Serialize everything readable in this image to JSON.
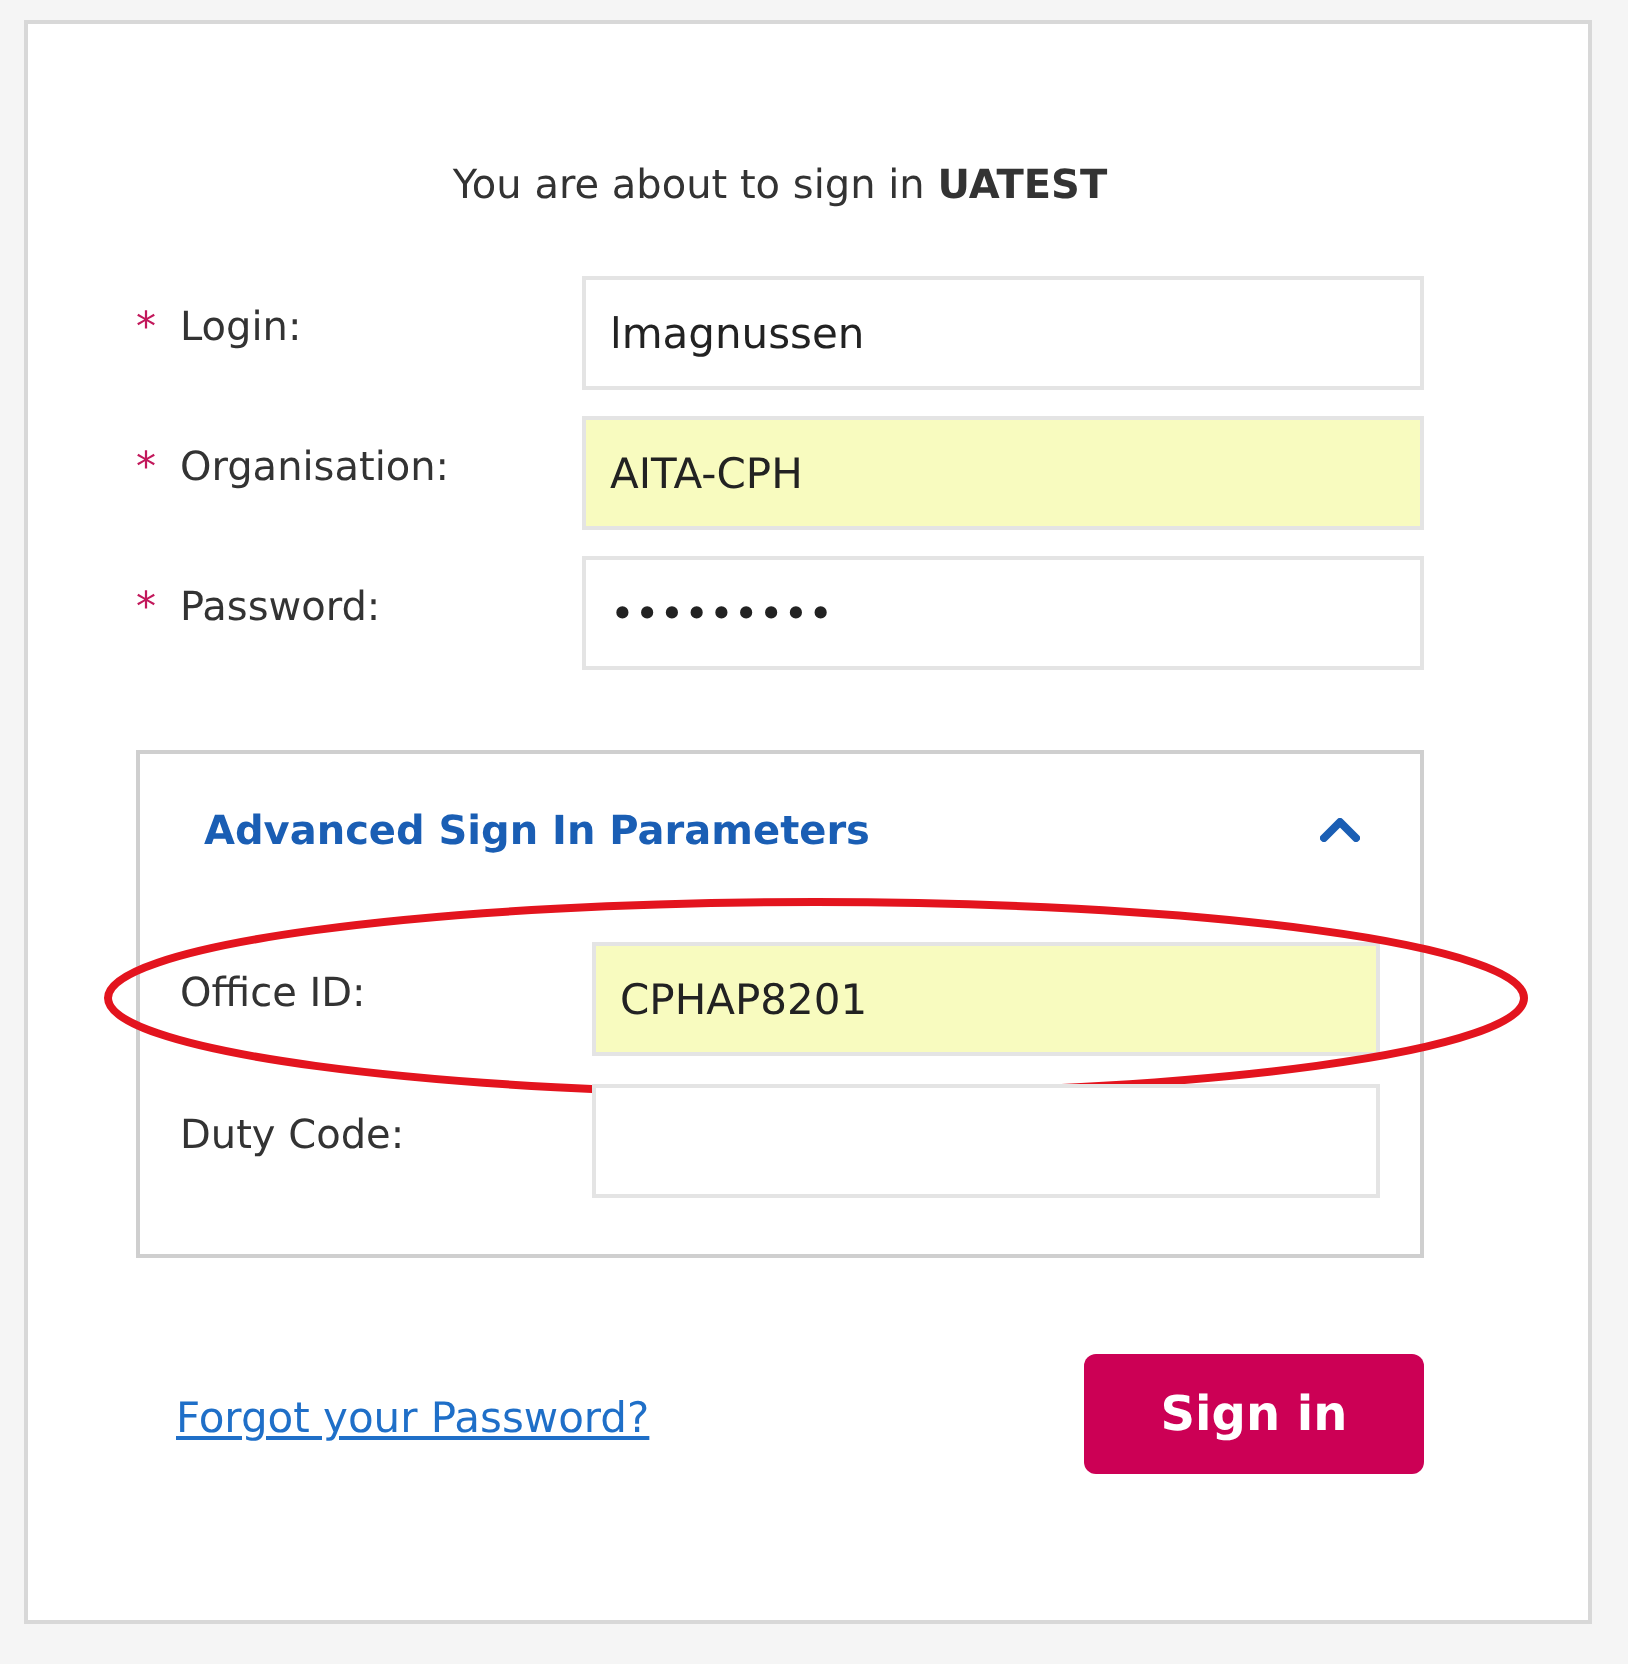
{
  "heading": "You are about to sign in **UATEST**",
  "fields": [
    {
      "label": "Login:",
      "required_mark": "*",
      "value": "lmagnussen",
      "autofilled": false
    },
    {
      "label": "Organisation:",
      "required_mark": "*",
      "value": "AITA-CPH",
      "autofilled": true
    },
    {
      "label": "Password:",
      "required_mark": "*",
      "value": "•••••••••",
      "autofilled": false
    }
  ],
  "advanced": {
    "title": "Advanced Sign In Parameters",
    "expanded": true,
    "fields": [
      {
        "label": "Office ID:",
        "value": "CPHAP8201",
        "autofilled": true,
        "circled": true
      },
      {
        "label": "Duty Code:",
        "autofilled": false,
        "circled": false
      }
    ]
  },
  "forgot_link": "Forgot your Password?",
  "sign_in_button": "Sign in"
}
